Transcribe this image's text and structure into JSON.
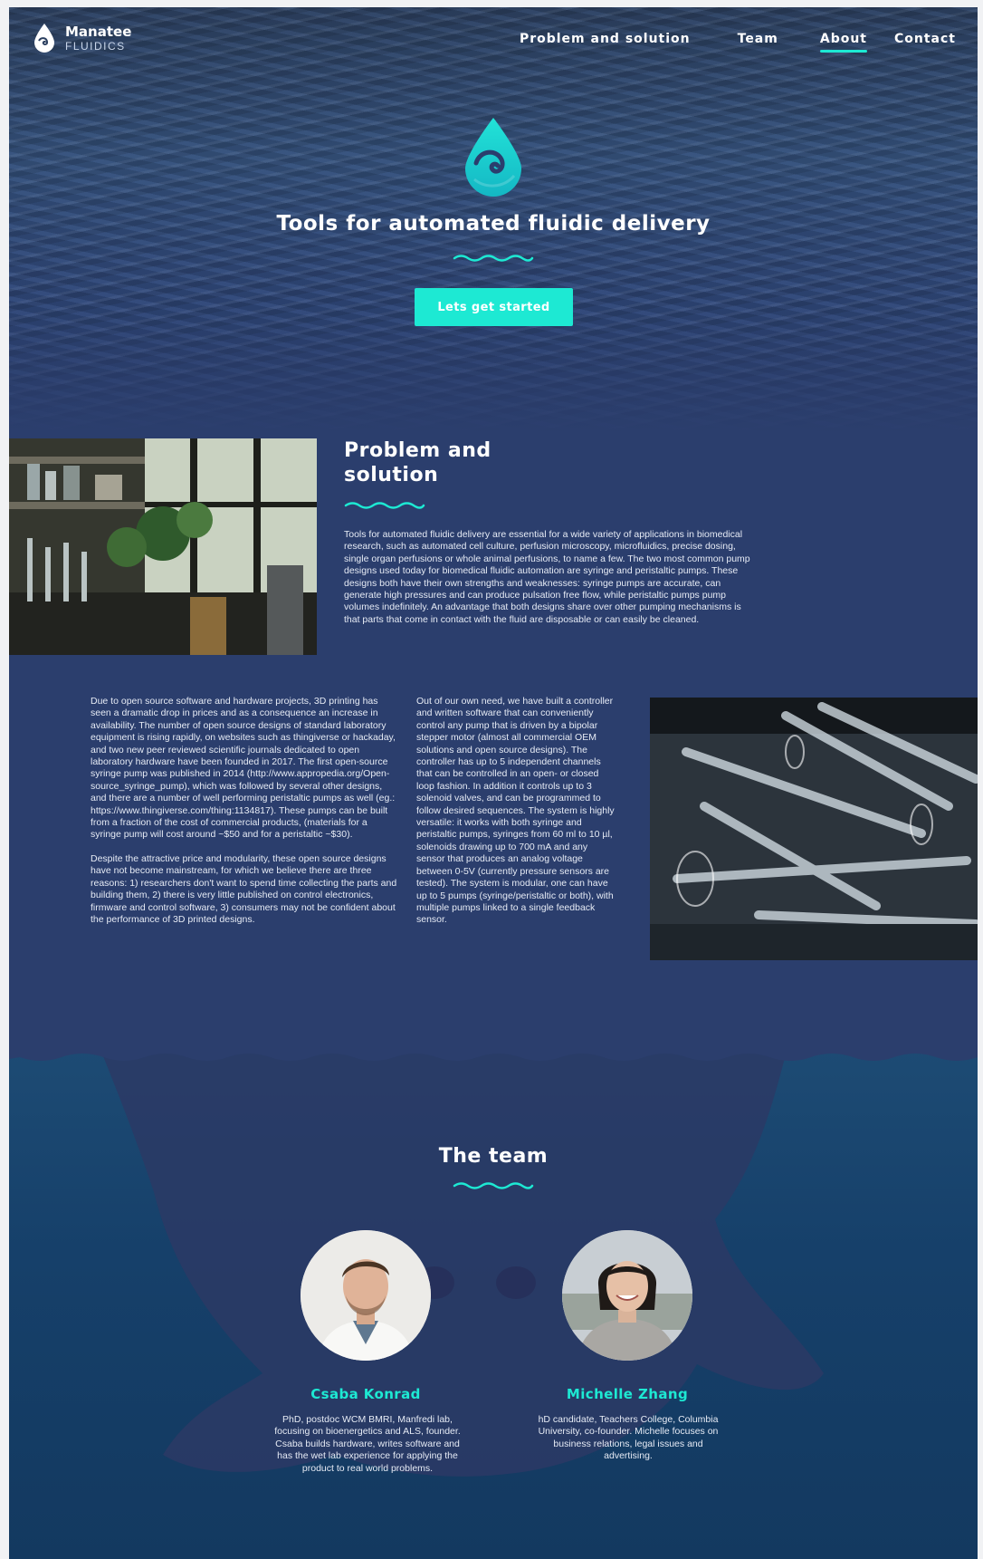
{
  "brand": {
    "name": "Manatee",
    "sub": "FLUIDICS",
    "logo_icon": "drop-logo-icon"
  },
  "nav": {
    "items": [
      {
        "label": "Problem and solution"
      },
      {
        "label": "Team"
      },
      {
        "label": "About",
        "active": true
      },
      {
        "label": "Contact"
      }
    ]
  },
  "hero": {
    "title": "Tools for automated fluidic delivery",
    "cta": "Lets get started"
  },
  "problem": {
    "title": "Problem and solution",
    "paragraph": "Tools for automated fluidic delivery are essential for a wide variety of applications in biomedical research, such as automated cell culture, perfusion microscopy, microfluidics, precise dosing, single organ perfusions or whole animal perfusions, to name a few. The two most common pump designs used today for biomedical fluidic automation are syringe and peristaltic pumps. These designs both have their own strengths and weaknesses: syringe pumps are accurate, can generate high pressures and can produce pulsation free flow, while peristaltic pumps pump volumes indefinitely. An advantage that both designs share over other pumping mechanisms is that parts that come in contact with the fluid are disposable or can easily be cleaned.",
    "col_left_1": "Due to open source software and hardware projects, 3D printing has seen a dramatic drop in prices and as a consequence an increase in availability. The number of open source designs of standard laboratory equipment is rising rapidly, on websites such as thingiverse or hackaday, and two new peer reviewed scientific journals dedicated to open laboratory hardware have been founded in 2017. The first open-source syringe pump was published in 2014 (http://www.appropedia.org/Open-source_syringe_pump), which was followed by several other designs, and there are a number of well performing peristaltic pumps as well (eg.: https://www.thingiverse.com/thing:1134817). These pumps can be built from a fraction of the cost of commercial products, (materials for a syringe pump will cost around ~$50 and for a peristaltic ~$30).",
    "col_left_2": "Despite the attractive price and modularity, these open source designs have not become mainstream, for which we believe there are three reasons: 1) researchers don't want to spend time collecting the parts and building them, 2) there is very little published on control electronics, firmware and control software, 3) consumers may not be confident about the performance of 3D printed designs.",
    "col_mid": "Out of our own need, we have built a controller and written software that can conveniently control any pump that is driven by a bipolar stepper motor (almost all commercial OEM solutions and open source designs). The controller has up to 5 independent channels that can be controlled in an open- or closed loop fashion. In addition it controls up to 3 solenoid valves, and can be programmed to follow desired sequences. The system is highly versatile: it works with both syringe and peristaltic pumps, syringes from 60 ml to 10 µl, solenoids drawing up to 700 mA and any sensor that produces an analog voltage between 0-5V (currently pressure sensors are tested). The system is modular, one can have up to 5 pumps (syringe/peristaltic or both), with multiple pumps linked to a single feedback sensor."
  },
  "team": {
    "title": "The team",
    "members": [
      {
        "name": "Csaba Konrad",
        "bio": "PhD, postdoc WCM BMRI, Manfredi lab, focusing on bioenergetics and ALS, founder. Csaba builds hardware, writes software and has the wet lab experience for applying the product to real world problems."
      },
      {
        "name": "Michelle Zhang",
        "bio": "hD candidate, Teachers College, Columbia University, co-founder. Michelle focuses on business relations, legal issues and advertising."
      }
    ]
  },
  "colors": {
    "accent": "#1de9d3",
    "background": "#2b3e6d",
    "team_background": "#16406a"
  }
}
